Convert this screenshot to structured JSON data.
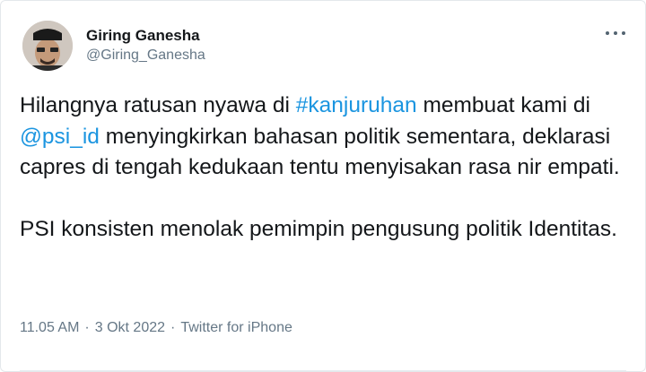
{
  "tweet": {
    "author": {
      "name": "Giring Ganesha",
      "handle": "@Giring_Ganesha"
    },
    "paragraph1": {
      "t1": "Hilangnya ratusan nyawa di ",
      "hashtag": "#kanjuruhan",
      "t2": " membuat kami di ",
      "mention": "@psi_id",
      "t3": " menyingkirkan bahasan politik sementara, deklarasi capres di tengah kedukaan tentu menyisakan rasa nir empati."
    },
    "paragraph2": "PSI konsisten menolak pemimpin pengusung politik Identitas.",
    "meta": {
      "time": "11.05 AM",
      "date": "3 Okt 2022",
      "source": "Twitter for iPhone",
      "separator": "·"
    }
  },
  "icons": {
    "more": "more-icon",
    "avatar": "avatar-image"
  },
  "colors": {
    "link": "#1b95e0",
    "text": "#14171a",
    "muted": "#657786"
  }
}
